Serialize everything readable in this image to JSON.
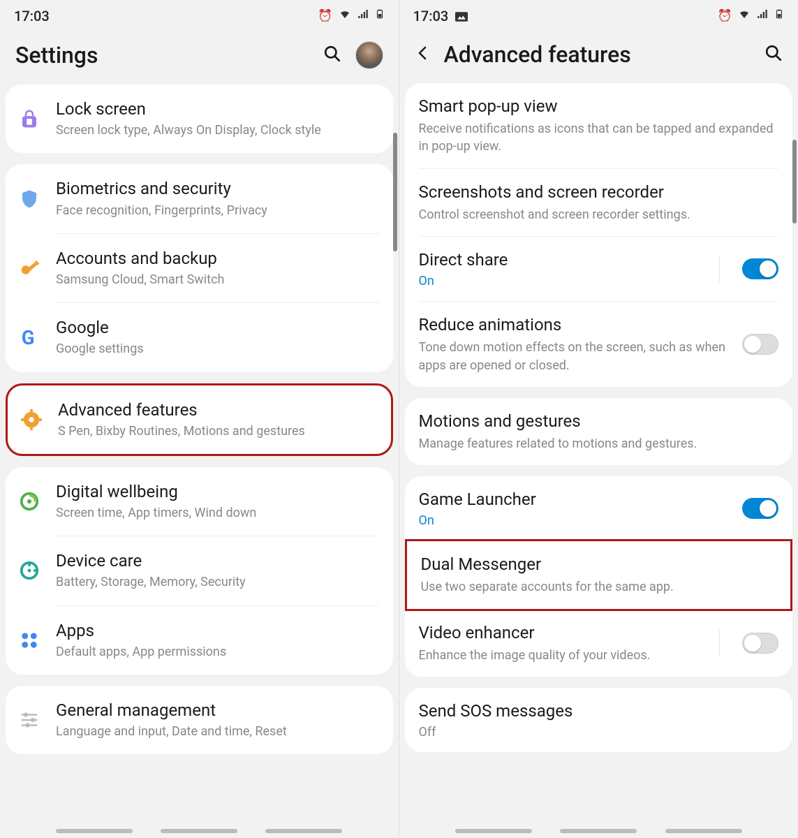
{
  "left": {
    "statusbar": {
      "time": "17:03"
    },
    "header": {
      "title": "Settings"
    },
    "groups": [
      {
        "highlighted": false,
        "items": [
          {
            "key": "lock-screen",
            "icon": "lock",
            "color": "#9d7ce8",
            "title": "Lock screen",
            "sub": "Screen lock type, Always On Display, Clock style"
          }
        ]
      },
      {
        "highlighted": false,
        "items": [
          {
            "key": "biometrics",
            "icon": "shield",
            "color": "#6fa8e8",
            "title": "Biometrics and security",
            "sub": "Face recognition, Fingerprints, Privacy"
          },
          {
            "key": "accounts-backup",
            "icon": "key",
            "color": "#f0a030",
            "title": "Accounts and backup",
            "sub": "Samsung Cloud, Smart Switch"
          },
          {
            "key": "google",
            "icon": "google",
            "color": "#4285f4",
            "title": "Google",
            "sub": "Google settings"
          }
        ]
      },
      {
        "highlighted": true,
        "items": [
          {
            "key": "advanced-features",
            "icon": "gear",
            "color": "#f0a030",
            "title": "Advanced features",
            "sub": "S Pen, Bixby Routines, Motions and gestures"
          }
        ]
      },
      {
        "highlighted": false,
        "items": [
          {
            "key": "digital-wellbeing",
            "icon": "wellbeing",
            "color": "#4caf50",
            "title": "Digital wellbeing",
            "sub": "Screen time, App timers, Wind down"
          },
          {
            "key": "device-care",
            "icon": "devicecare",
            "color": "#26a69a",
            "title": "Device care",
            "sub": "Battery, Storage, Memory, Security"
          },
          {
            "key": "apps",
            "icon": "apps",
            "color": "#4285f4",
            "title": "Apps",
            "sub": "Default apps, App permissions"
          }
        ]
      },
      {
        "highlighted": false,
        "items": [
          {
            "key": "general-management",
            "icon": "sliders",
            "color": "#bbb",
            "title": "General management",
            "sub": "Language and input, Date and time, Reset"
          }
        ]
      }
    ]
  },
  "right": {
    "statusbar": {
      "time": "17:03"
    },
    "header": {
      "title": "Advanced features"
    },
    "groups": [
      {
        "items": [
          {
            "key": "smart-popup",
            "title": "Smart pop-up view",
            "sub": "Receive notifications as icons that can be tapped and expanded in pop-up view.",
            "toggle": null,
            "highlighted": false
          },
          {
            "key": "screenshots",
            "title": "Screenshots and screen recorder",
            "sub": "Control screenshot and screen recorder settings.",
            "toggle": null,
            "highlighted": false
          },
          {
            "key": "direct-share",
            "title": "Direct share",
            "status": "On",
            "toggle": "on",
            "sep": true,
            "highlighted": false
          },
          {
            "key": "reduce-animations",
            "title": "Reduce animations",
            "sub": "Tone down motion effects on the screen, such as when apps are opened or closed.",
            "toggle": "off",
            "highlighted": false
          }
        ]
      },
      {
        "items": [
          {
            "key": "motions-gestures",
            "title": "Motions and gestures",
            "sub": "Manage features related to motions and gestures.",
            "toggle": null,
            "highlighted": false
          }
        ]
      },
      {
        "items": [
          {
            "key": "game-launcher",
            "title": "Game Launcher",
            "status": "On",
            "toggle": "on",
            "highlighted": false
          },
          {
            "key": "dual-messenger",
            "title": "Dual Messenger",
            "sub": "Use two separate accounts for the same app.",
            "toggle": null,
            "highlighted": true
          },
          {
            "key": "video-enhancer",
            "title": "Video enhancer",
            "sub": "Enhance the image quality of your videos.",
            "toggle": "off",
            "sep": true,
            "highlighted": false
          }
        ]
      },
      {
        "items": [
          {
            "key": "send-sos",
            "title": "Send SOS messages",
            "status": "Off",
            "toggle": null,
            "highlighted": false
          }
        ]
      }
    ]
  }
}
